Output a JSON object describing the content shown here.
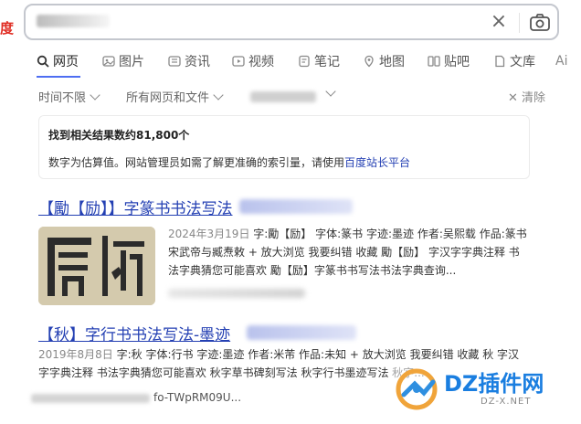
{
  "header": {
    "logo_fragment": "度",
    "search": {
      "value": ""
    }
  },
  "tabs": [
    {
      "label": "网页",
      "icon": "search-icon",
      "active": true
    },
    {
      "label": "图片",
      "icon": "image-icon"
    },
    {
      "label": "资讯",
      "icon": "news-icon"
    },
    {
      "label": "视频",
      "icon": "video-icon"
    },
    {
      "label": "笔记",
      "icon": "note-icon"
    },
    {
      "label": "地图",
      "icon": "map-icon"
    },
    {
      "label": "贴吧",
      "icon": "tieba-icon"
    },
    {
      "label": "文库",
      "icon": "doc-icon"
    },
    {
      "label": "Ai",
      "icon": "ai-icon"
    }
  ],
  "filters": {
    "time": "时间不限",
    "scope": "所有网页和文件",
    "clear": "清除"
  },
  "notice": {
    "count": "找到相关结果数约81,800个",
    "note_prefix": "数字为估算值。网站管理员如需了解更准确的索引量，请使用",
    "note_link": "百度站长平台"
  },
  "results": [
    {
      "title": "【勵【励】】字篆书书法写法",
      "snippet_date": "2024年3月19日",
      "snippet_line1": " 字:勵【励】 字体:篆书 字迹:墨迹 作者:吴熙载 作品:篆书",
      "snippet_line2": "宋武帝与臧焘敕 + 放大浏览 我要纠错 收藏 勵【励】 字汉字字典注释 书",
      "snippet_line3": "法字典猜您可能喜欢 勵【励】字篆书书写法书法字典查询..."
    },
    {
      "title": "【秋】字行书书法写法-墨迹",
      "snippet_date": "2019年8月8日",
      "snippet_line1": " 字:秋 字体:行书 字迹:墨迹 作者:米芾 作品:未知 + 放大浏览 我要纠错 收藏 秋 字汉",
      "snippet_line2": "字字典注释 书法字典猜您可能喜欢 秋字草书碑刻写法 秋字行书墨迹写法 秋字...",
      "url_fragment": "fo-TWpRM09U..."
    }
  ],
  "watermark": {
    "brand": "DZ插件网",
    "domain": "DZ-X.NET"
  },
  "colors": {
    "link": "#2440b3",
    "accent": "#4e6ef2",
    "logo_red": "#e02e24"
  }
}
